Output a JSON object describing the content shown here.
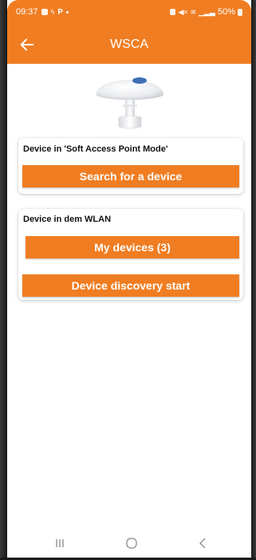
{
  "status_bar": {
    "time": "09:37",
    "battery": "50%"
  },
  "app_bar": {
    "title": "WSCA",
    "back_icon": "arrow-left-icon"
  },
  "soft_ap_card": {
    "title": "Device in 'Soft Access Point Mode'",
    "search_button": "Search for a device"
  },
  "wlan_card": {
    "title": "Device in dem WLAN",
    "my_devices_button": "My devices (3)",
    "discovery_button": "Device discovery start"
  },
  "nav_bar": {
    "recents_icon": "recents-icon",
    "home_icon": "home-icon",
    "back_icon": "back-chevron-icon"
  },
  "colors": {
    "accent": "#f07d22",
    "background": "#ffffff"
  }
}
